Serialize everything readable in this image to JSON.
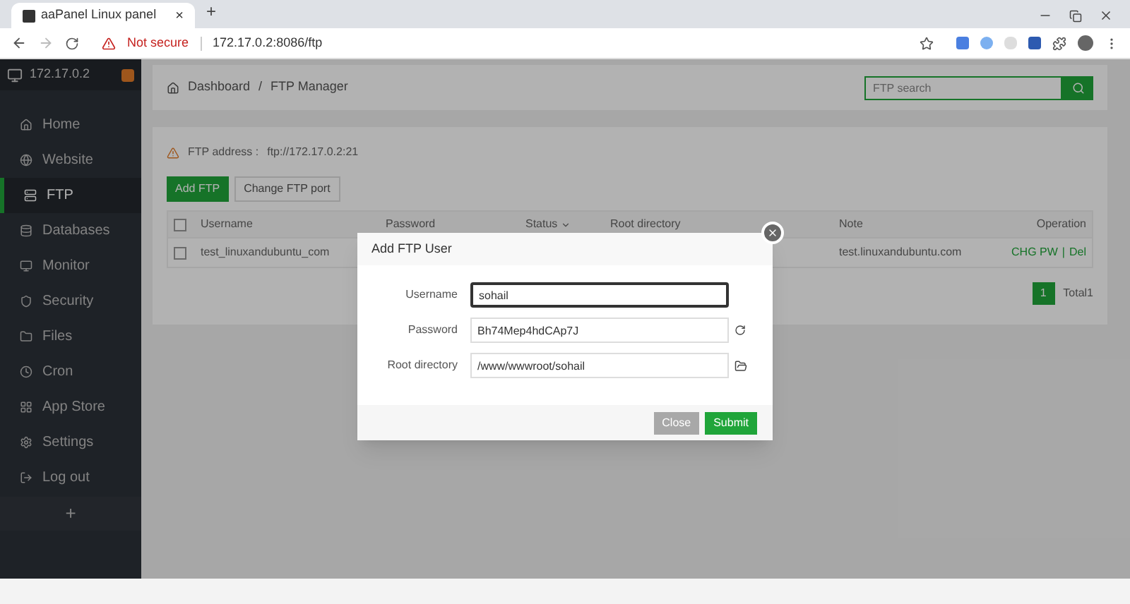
{
  "browser": {
    "tab": {
      "title": "aaPanel Linux panel",
      "close": "×"
    },
    "new_tab": "+",
    "address": {
      "security": "Not secure",
      "url": "172.17.0.2:8086/ftp"
    }
  },
  "sidebar": {
    "server": "172.17.0.2",
    "items": [
      {
        "label": "Home",
        "selected": false
      },
      {
        "label": "Website",
        "selected": false
      },
      {
        "label": "FTP",
        "selected": true
      },
      {
        "label": "Databases",
        "selected": false
      },
      {
        "label": "Monitor",
        "selected": false
      },
      {
        "label": "Security",
        "selected": false
      },
      {
        "label": "Files",
        "selected": false
      },
      {
        "label": "Cron",
        "selected": false
      },
      {
        "label": "App Store",
        "selected": false
      },
      {
        "label": "Settings",
        "selected": false
      },
      {
        "label": "Log out",
        "selected": false
      }
    ],
    "add": "+"
  },
  "breadcrumb": {
    "items": [
      "Dashboard",
      "FTP Manager"
    ],
    "separator": "/"
  },
  "search": {
    "placeholder": "FTP search"
  },
  "ftp_address": {
    "label": "FTP address :",
    "value": "ftp://172.17.0.2:21"
  },
  "buttons": [
    {
      "label": "Add FTP",
      "kind": "primary"
    },
    {
      "label": "Change FTP port",
      "kind": "default"
    }
  ],
  "table": {
    "select_all_checked": false,
    "columns": [
      "Username",
      "Password",
      "Status",
      "Root directory",
      "Note",
      "Operation"
    ],
    "rows": [
      {
        "checked": false,
        "username": "test_linuxandubuntu_com",
        "note": "test.linuxandubuntu.com",
        "operations": [
          "CHG PW",
          "Del"
        ]
      }
    ],
    "operation_separator": "|"
  },
  "pagination": {
    "pages": [
      {
        "label": "1",
        "selected": true
      }
    ],
    "total": "Total1"
  },
  "modal": {
    "title": "Add FTP User",
    "fields": [
      {
        "label": "Username",
        "value": "sohail",
        "kind": "text",
        "focused": true
      },
      {
        "label": "Password",
        "value": "Bh74Mep4hdCAp7J",
        "kind": "password",
        "focused": false
      },
      {
        "label": "Root directory",
        "value": "/www/wwwroot/sohail",
        "kind": "path",
        "focused": false
      }
    ],
    "buttons": [
      {
        "label": "Close",
        "kind": "secondary"
      },
      {
        "label": "Submit",
        "kind": "primary"
      }
    ]
  }
}
